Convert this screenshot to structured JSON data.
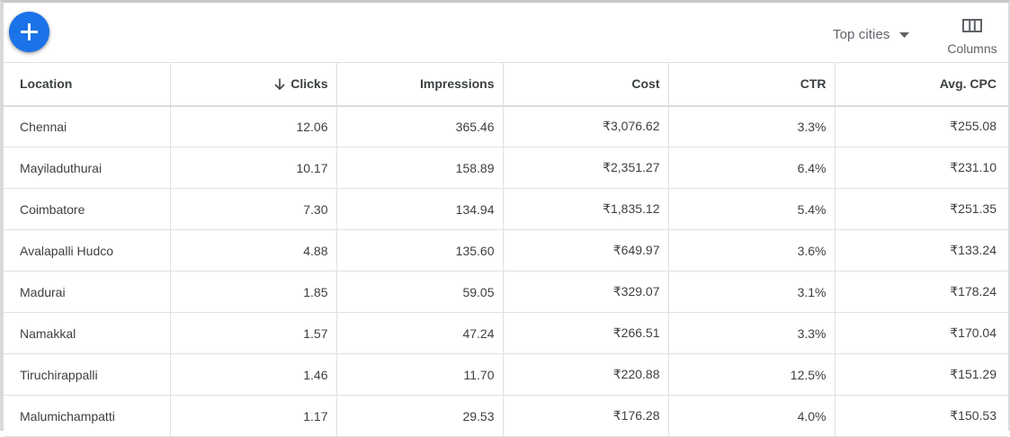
{
  "toolbar": {
    "add_icon": "plus-icon",
    "segment_label": "Top cities",
    "segment_icon": "caret-down-icon",
    "columns_label": "Columns",
    "columns_icon": "columns-icon",
    "accent_color": "#1a73e8"
  },
  "table": {
    "headers": {
      "location": "Location",
      "clicks": "Clicks",
      "impressions": "Impressions",
      "cost": "Cost",
      "ctr": "CTR",
      "avg_cpc": "Avg. CPC"
    },
    "sort": {
      "column": "clicks",
      "direction": "descending",
      "icon": "arrow-down-icon"
    },
    "rows": [
      {
        "location": "Chennai",
        "clicks": "12.06",
        "impressions": "365.46",
        "cost": "₹3,076.62",
        "ctr": "3.3%",
        "avg_cpc": "₹255.08"
      },
      {
        "location": "Mayiladuthurai",
        "clicks": "10.17",
        "impressions": "158.89",
        "cost": "₹2,351.27",
        "ctr": "6.4%",
        "avg_cpc": "₹231.10"
      },
      {
        "location": "Coimbatore",
        "clicks": "7.30",
        "impressions": "134.94",
        "cost": "₹1,835.12",
        "ctr": "5.4%",
        "avg_cpc": "₹251.35"
      },
      {
        "location": "Avalapalli Hudco",
        "clicks": "4.88",
        "impressions": "135.60",
        "cost": "₹649.97",
        "ctr": "3.6%",
        "avg_cpc": "₹133.24"
      },
      {
        "location": "Madurai",
        "clicks": "1.85",
        "impressions": "59.05",
        "cost": "₹329.07",
        "ctr": "3.1%",
        "avg_cpc": "₹178.24"
      },
      {
        "location": "Namakkal",
        "clicks": "1.57",
        "impressions": "47.24",
        "cost": "₹266.51",
        "ctr": "3.3%",
        "avg_cpc": "₹170.04"
      },
      {
        "location": "Tiruchirappalli",
        "clicks": "1.46",
        "impressions": "11.70",
        "cost": "₹220.88",
        "ctr": "12.5%",
        "avg_cpc": "₹151.29"
      },
      {
        "location": "Malumichampatti",
        "clicks": "1.17",
        "impressions": "29.53",
        "cost": "₹176.28",
        "ctr": "4.0%",
        "avg_cpc": "₹150.53"
      }
    ]
  }
}
